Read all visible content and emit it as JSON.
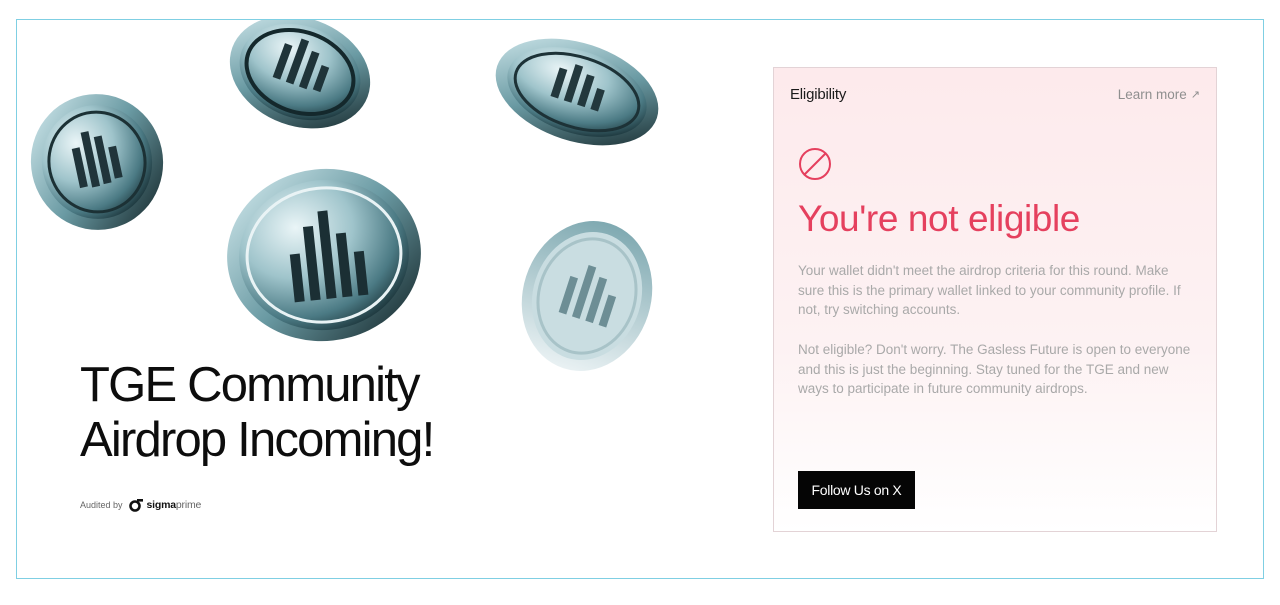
{
  "hero": {
    "title_line1": "TGE Community",
    "title_line2": "Airdrop Incoming!",
    "audited_by": "Audited by",
    "auditor_name": "sigma",
    "auditor_name_suffix": "prime"
  },
  "eligibility": {
    "title": "Eligibility",
    "learn_more": "Learn more",
    "learn_more_icon": "↗",
    "status_icon": "ban-icon",
    "headline": "You're not eligible",
    "paragraph1": "Your wallet didn't meet the airdrop criteria for this round. Make sure this is the primary wallet linked to your community profile. If not, try switching accounts.",
    "paragraph2": "Not eligible? Don't worry. The Gasless Future is open to everyone and this is just the beginning. Stay tuned for the TGE and new ways to participate in future community airdrops.",
    "follow_button": "Follow Us on X"
  },
  "colors": {
    "accent": "#e5405e",
    "frame_border": "#7fcfe3",
    "card_background": "#fdeaec",
    "button_background": "#050505"
  }
}
